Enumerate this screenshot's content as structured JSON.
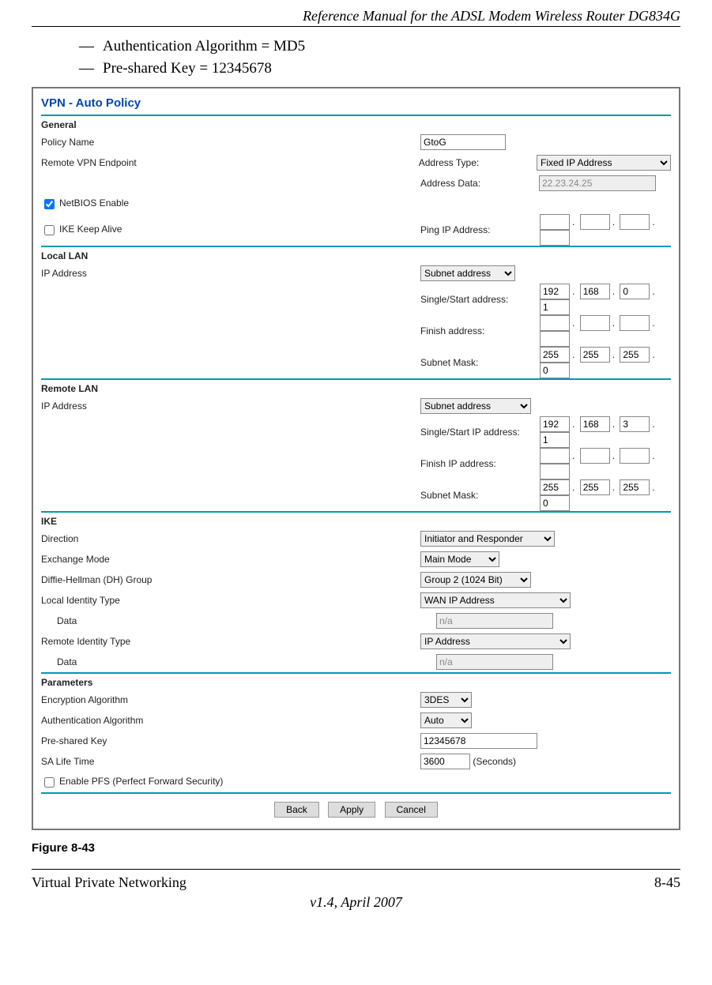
{
  "doc": {
    "header_title": "Reference Manual for the ADSL Modem Wireless Router DG834G",
    "bullets": [
      "Authentication Algorithm = MD5",
      "Pre-shared Key = 12345678"
    ],
    "figure_caption": "Figure 8-43",
    "footer_left": "Virtual Private Networking",
    "footer_right": "8-45",
    "footer_version": "v1.4, April 2007"
  },
  "ui": {
    "title": "VPN - Auto Policy",
    "general": {
      "heading": "General",
      "policy_name_label": "Policy Name",
      "policy_name_value": "GtoG",
      "remote_endpoint_label": "Remote VPN Endpoint",
      "address_type_label": "Address Type:",
      "address_type_value": "Fixed IP Address",
      "address_data_label": "Address Data:",
      "address_data_value": "22.23.24.25",
      "netbios_label": "NetBIOS Enable",
      "netbios_checked": true,
      "ike_keepalive_label": "IKE Keep Alive",
      "ike_keepalive_checked": false,
      "ping_ip_label": "Ping IP Address:",
      "ping_ip": [
        "",
        "",
        "",
        ""
      ]
    },
    "local_lan": {
      "heading": "Local LAN",
      "ip_label": "IP Address",
      "type_value": "Subnet address",
      "single_start_label": "Single/Start address:",
      "single_start": [
        "192",
        "168",
        "0",
        "1"
      ],
      "finish_label": "Finish address:",
      "finish": [
        "",
        "",
        "",
        ""
      ],
      "subnet_label": "Subnet Mask:",
      "subnet": [
        "255",
        "255",
        "255",
        "0"
      ]
    },
    "remote_lan": {
      "heading": "Remote LAN",
      "ip_label": "IP Address",
      "type_value": "Subnet address",
      "single_start_label": "Single/Start IP address:",
      "single_start": [
        "192",
        "168",
        "3",
        "1"
      ],
      "finish_label": "Finish IP address:",
      "finish": [
        "",
        "",
        "",
        ""
      ],
      "subnet_label": "Subnet Mask:",
      "subnet": [
        "255",
        "255",
        "255",
        "0"
      ]
    },
    "ike": {
      "heading": "IKE",
      "direction_label": "Direction",
      "direction_value": "Initiator and Responder",
      "exchange_label": "Exchange Mode",
      "exchange_value": "Main Mode",
      "dh_label": "Diffie-Hellman (DH) Group",
      "dh_value": "Group 2 (1024 Bit)",
      "local_id_type_label": "Local Identity Type",
      "local_id_type_value": "WAN IP Address",
      "local_id_data_label": "Data",
      "local_id_data_value": "n/a",
      "remote_id_type_label": "Remote Identity Type",
      "remote_id_type_value": "IP Address",
      "remote_id_data_label": "Data",
      "remote_id_data_value": "n/a"
    },
    "params": {
      "heading": "Parameters",
      "enc_label": "Encryption Algorithm",
      "enc_value": "3DES",
      "auth_label": "Authentication Algorithm",
      "auth_value": "Auto",
      "psk_label": "Pre-shared Key",
      "psk_value": "12345678",
      "sa_label": "SA Life Time",
      "sa_value": "3600",
      "sa_unit": "(Seconds)",
      "pfs_label": "Enable PFS (Perfect Forward Security)",
      "pfs_checked": false
    },
    "buttons": {
      "back": "Back",
      "apply": "Apply",
      "cancel": "Cancel"
    }
  }
}
